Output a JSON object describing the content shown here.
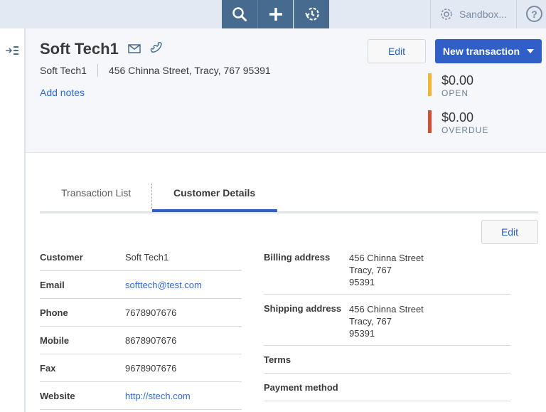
{
  "topbar": {
    "search_icon": "search-icon",
    "add_icon": "plus-icon",
    "recent_icon": "history-icon",
    "company_label": "Sandbox...",
    "help_label": "?"
  },
  "header": {
    "customer_name": "Soft Tech1",
    "company": "Soft Tech1",
    "address": "456 Chinna Street, Tracy, 767 95391",
    "add_notes": "Add notes",
    "edit_label": "Edit",
    "new_transaction_label": "New transaction",
    "stats": [
      {
        "amount": "$0.00",
        "label": "OPEN",
        "color": "#f2b632"
      },
      {
        "amount": "$0.00",
        "label": "OVERDUE",
        "color": "#d04f35"
      }
    ]
  },
  "tabs": [
    {
      "label": "Transaction List",
      "active": false
    },
    {
      "label": "Customer Details",
      "active": true
    }
  ],
  "details": {
    "edit_label": "Edit",
    "left": [
      {
        "key": "Customer",
        "value": "Soft Tech1"
      },
      {
        "key": "Email",
        "value": "softtech@test.com"
      },
      {
        "key": "Phone",
        "value": "7678907676"
      },
      {
        "key": "Mobile",
        "value": "8678907676"
      },
      {
        "key": "Fax",
        "value": "9678907676"
      },
      {
        "key": "Website",
        "value": "http://stech.com"
      }
    ],
    "right": [
      {
        "key": "Billing address",
        "lines": [
          "456 Chinna Street",
          "Tracy, 767",
          "95391"
        ]
      },
      {
        "key": "Shipping address",
        "lines": [
          "456 Chinna Street",
          "Tracy, 767",
          "95391"
        ]
      },
      {
        "key": "Terms",
        "value": ""
      },
      {
        "key": "Payment method",
        "value": ""
      }
    ]
  },
  "colors": {
    "accent": "#2f5fc7",
    "topbar_button": "#466b8f",
    "link": "#2d6ad6"
  }
}
